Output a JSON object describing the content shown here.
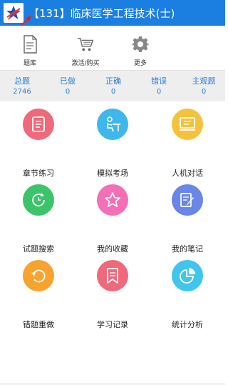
{
  "header": {
    "title": "【131】临床医学工程技术(士)",
    "color": "#1a7fe0"
  },
  "toolbar": {
    "items": [
      {
        "label": "题库",
        "icon": "book-icon"
      },
      {
        "label": "激活/购买",
        "icon": "cart-icon"
      },
      {
        "label": "更多",
        "icon": "gear-icon"
      }
    ]
  },
  "stats": [
    {
      "label": "总题",
      "value": "2746"
    },
    {
      "label": "已做",
      "value": "0"
    },
    {
      "label": "正确",
      "value": "0"
    },
    {
      "label": "错误",
      "value": "0"
    },
    {
      "label": "主观题",
      "value": "0"
    }
  ],
  "grid": [
    {
      "label": "章节练习",
      "icon": "document-icon",
      "color": "#f0697a"
    },
    {
      "label": "模拟考场",
      "icon": "exam-desk-icon",
      "color": "#3eb8ec"
    },
    {
      "label": "人机对话",
      "icon": "monitor-icon",
      "color": "#f5c23d"
    },
    {
      "label": "试题搜索",
      "icon": "clock-search-icon",
      "color": "#3cc46a"
    },
    {
      "label": "我的收藏",
      "icon": "star-icon",
      "color": "#f46fb5"
    },
    {
      "label": "我的笔记",
      "icon": "notes-icon",
      "color": "#6a86e8"
    },
    {
      "label": "错题重做",
      "icon": "redo-icon",
      "color": "#f7a330"
    },
    {
      "label": "学习记录",
      "icon": "bookmark-icon",
      "color": "#f0697a"
    },
    {
      "label": "统计分析",
      "icon": "pie-chart-icon",
      "color": "#40c6ec"
    }
  ],
  "accent": "#2a7fd4"
}
